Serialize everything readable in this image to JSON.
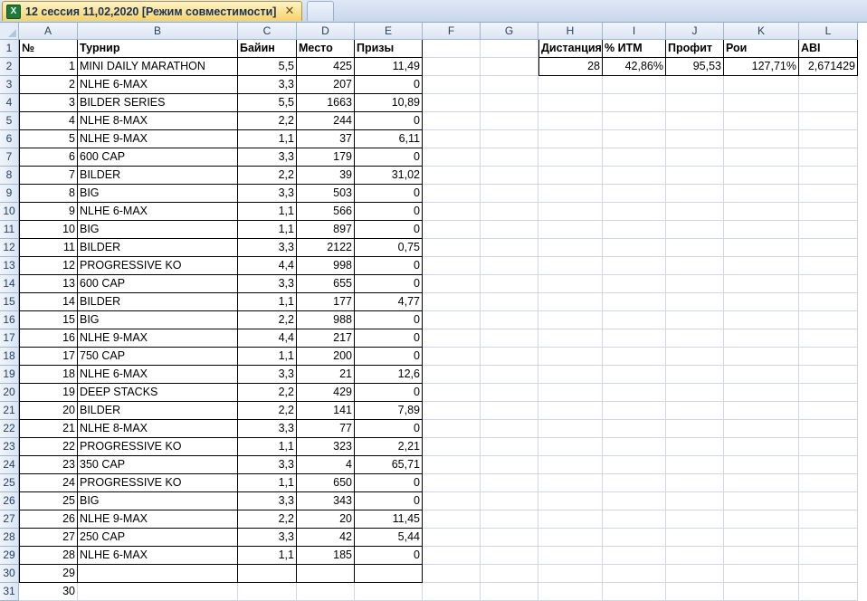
{
  "window": {
    "tab_title": "12 сессия 11,02,2020  [Режим совместимости]",
    "close_glyph": "✕",
    "app_icon_letter": "X"
  },
  "columns": [
    "A",
    "B",
    "C",
    "D",
    "E",
    "F",
    "G",
    "H",
    "I",
    "J",
    "K",
    "L"
  ],
  "headers": {
    "num": "№",
    "tournament": "Турнир",
    "buyin": "Байин",
    "place": "Место",
    "prize": "Призы"
  },
  "rows": [
    {
      "n": "1",
      "name": "MINI DAILY MARATHON",
      "buyin": "5,5",
      "place": "425",
      "prize": "11,49"
    },
    {
      "n": "2",
      "name": "NLHE 6-MAX",
      "buyin": "3,3",
      "place": "207",
      "prize": "0"
    },
    {
      "n": "3",
      "name": "BILDER SERIES",
      "buyin": "5,5",
      "place": "1663",
      "prize": "10,89"
    },
    {
      "n": "4",
      "name": "NLHE 8-MAX",
      "buyin": "2,2",
      "place": "244",
      "prize": "0"
    },
    {
      "n": "5",
      "name": "NLHE 9-MAX",
      "buyin": "1,1",
      "place": "37",
      "prize": "6,11"
    },
    {
      "n": "6",
      "name": "600 CAP",
      "buyin": "3,3",
      "place": "179",
      "prize": "0"
    },
    {
      "n": "7",
      "name": "BILDER",
      "buyin": "2,2",
      "place": "39",
      "prize": "31,02"
    },
    {
      "n": "8",
      "name": "BIG",
      "buyin": "3,3",
      "place": "503",
      "prize": "0"
    },
    {
      "n": "9",
      "name": "NLHE 6-MAX",
      "buyin": "1,1",
      "place": "566",
      "prize": "0"
    },
    {
      "n": "10",
      "name": "BIG",
      "buyin": "1,1",
      "place": "897",
      "prize": "0"
    },
    {
      "n": "11",
      "name": "BILDER",
      "buyin": "3,3",
      "place": "2122",
      "prize": "0,75"
    },
    {
      "n": "12",
      "name": "PROGRESSIVE KO",
      "buyin": "4,4",
      "place": "998",
      "prize": "0"
    },
    {
      "n": "13",
      "name": "600 CAP",
      "buyin": "3,3",
      "place": "655",
      "prize": "0"
    },
    {
      "n": "14",
      "name": "BILDER",
      "buyin": "1,1",
      "place": "177",
      "prize": "4,77"
    },
    {
      "n": "15",
      "name": "BIG",
      "buyin": "2,2",
      "place": "988",
      "prize": "0"
    },
    {
      "n": "16",
      "name": "NLHE 9-MAX",
      "buyin": "4,4",
      "place": "217",
      "prize": "0"
    },
    {
      "n": "17",
      "name": "750 CAP",
      "buyin": "1,1",
      "place": "200",
      "prize": "0"
    },
    {
      "n": "18",
      "name": "NLHE 6-MAX",
      "buyin": "3,3",
      "place": "21",
      "prize": "12,6"
    },
    {
      "n": "19",
      "name": "DEEP STACKS",
      "buyin": "2,2",
      "place": "429",
      "prize": "0"
    },
    {
      "n": "20",
      "name": "BILDER",
      "buyin": "2,2",
      "place": "141",
      "prize": "7,89"
    },
    {
      "n": "21",
      "name": "NLHE 8-MAX",
      "buyin": "3,3",
      "place": "77",
      "prize": "0"
    },
    {
      "n": "22",
      "name": "PROGRESSIVE KO",
      "buyin": "1,1",
      "place": "323",
      "prize": "2,21"
    },
    {
      "n": "23",
      "name": "350 CAP",
      "buyin": "3,3",
      "place": "4",
      "prize": "65,71"
    },
    {
      "n": "24",
      "name": "PROGRESSIVE KO",
      "buyin": "1,1",
      "place": "650",
      "prize": "0"
    },
    {
      "n": "25",
      "name": "BIG",
      "buyin": "3,3",
      "place": "343",
      "prize": "0"
    },
    {
      "n": "26",
      "name": "NLHE 9-MAX",
      "buyin": "2,2",
      "place": "20",
      "prize": "11,45"
    },
    {
      "n": "27",
      "name": "250 CAP",
      "buyin": "3,3",
      "place": "42",
      "prize": "5,44"
    },
    {
      "n": "28",
      "name": "NLHE 6-MAX",
      "buyin": "1,1",
      "place": "185",
      "prize": "0"
    },
    {
      "n": "29",
      "name": "",
      "buyin": "",
      "place": "",
      "prize": ""
    },
    {
      "n": "30",
      "name": "",
      "buyin": "",
      "place": "",
      "prize": ""
    }
  ],
  "stats": {
    "headers": {
      "distance": "Дистанция",
      "itm": "% ИТМ",
      "profit": "Профит",
      "roi": "Рои",
      "abi": "ABI"
    },
    "values": {
      "distance": "28",
      "itm": "42,86%",
      "profit": "95,53",
      "roi": "127,71%",
      "abi": "2,671429"
    }
  }
}
